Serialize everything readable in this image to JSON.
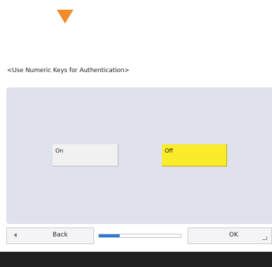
{
  "header": {
    "arrow_icon": "arrow-down-icon",
    "accent_color": "#f08c2a"
  },
  "screen": {
    "title": "<Use Numeric Keys for Authentication>"
  },
  "options": {
    "on_label": "On",
    "off_label": "Off",
    "selected": "Off",
    "selected_color": "#fbec2b"
  },
  "footer_bar": {
    "back_label": "Back",
    "ok_label": "OK",
    "progress_fraction": 0.25,
    "progress_color": "#2c78d6"
  }
}
